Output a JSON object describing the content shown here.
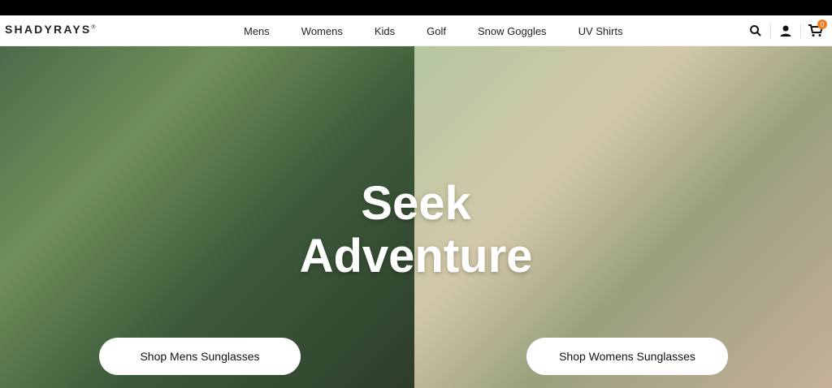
{
  "brand": {
    "name": "SHADYRAYS",
    "registered": "®"
  },
  "nav": {
    "items": [
      "Mens",
      "Womens",
      "Kids",
      "Golf",
      "Snow Goggles",
      "UV Shirts"
    ]
  },
  "header": {
    "cart_count": "0"
  },
  "hero": {
    "title_line1": "Seek",
    "title_line2": "Adventure",
    "btn_mens": "Shop Mens Sunglasses",
    "btn_womens": "Shop Womens Sunglasses"
  }
}
